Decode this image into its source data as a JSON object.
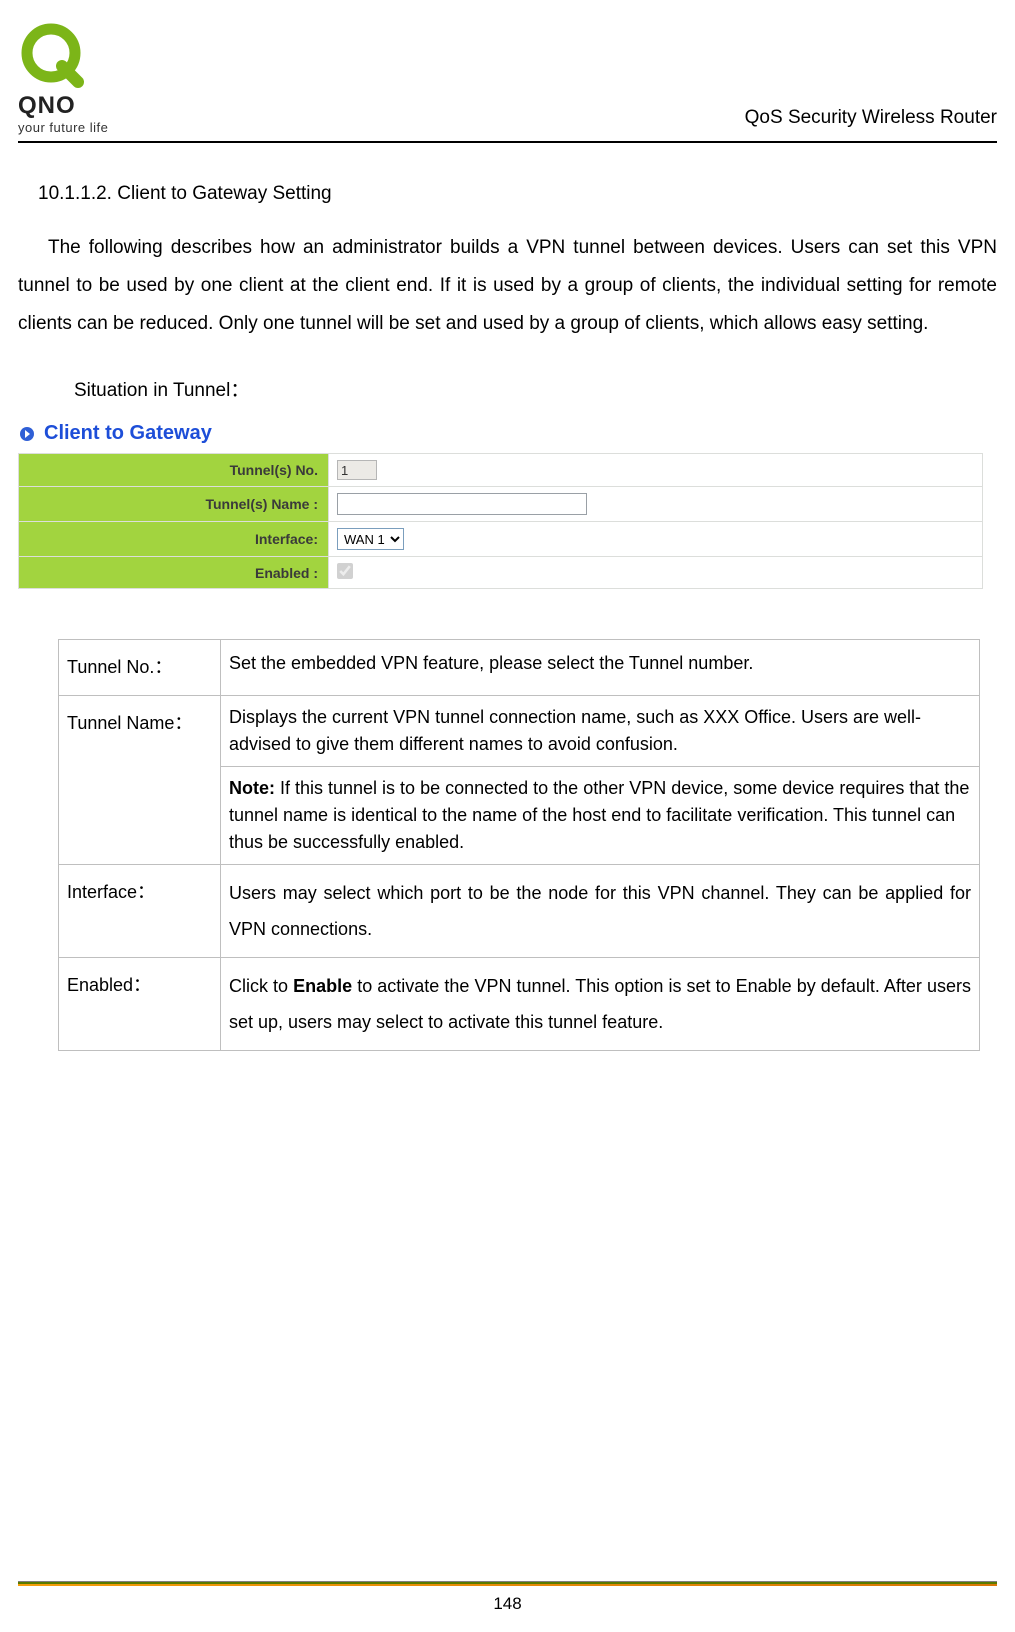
{
  "header": {
    "logo_text": "QNO",
    "tagline": "your future life",
    "right_text": "QoS Security Wireless Router"
  },
  "section": {
    "heading": "10.1.1.2. Client to Gateway Setting",
    "paragraph": "The following describes how an administrator builds a VPN tunnel between devices. Users can set this VPN tunnel to be used by one client at the client end. If it is used by a group of clients, the individual setting for remote clients can be reduced. Only one tunnel will be set and used by a group of clients, which allows easy setting.",
    "situation_label": "Situation in Tunnel："
  },
  "panel": {
    "title": "Client to Gateway",
    "rows": {
      "tunnel_no": {
        "label": "Tunnel(s) No.",
        "value": "1"
      },
      "tunnel_name": {
        "label": "Tunnel(s) Name :",
        "value": ""
      },
      "interface": {
        "label": "Interface:",
        "selected": "WAN 1"
      },
      "enabled": {
        "label": "Enabled :",
        "checked": true
      }
    }
  },
  "desc": {
    "tunnel_no": {
      "term": "Tunnel No.：",
      "text": "Set the embedded VPN feature, please select the Tunnel number."
    },
    "tunnel_name": {
      "term": "Tunnel Name：",
      "text1": "Displays the current VPN tunnel connection name, such as XXX Office. Users are well-advised to give them different names to avoid confusion.",
      "note_label": "Note:",
      "note_text": " If this tunnel is to be connected to the other VPN device, some device requires that the tunnel name is identical to the name of the host end to facilitate verification. This tunnel can thus be successfully enabled."
    },
    "interface": {
      "term": "Interface：",
      "text": "Users may select which port to be the node for this VPN channel. They can be applied for VPN connections."
    },
    "enabled": {
      "term": "Enabled：",
      "pre": "Click to ",
      "bold": "Enable",
      "post": " to activate the VPN tunnel. This option is set to Enable by default. After users set up, users may select to activate this tunnel feature."
    }
  },
  "page_number": "148"
}
